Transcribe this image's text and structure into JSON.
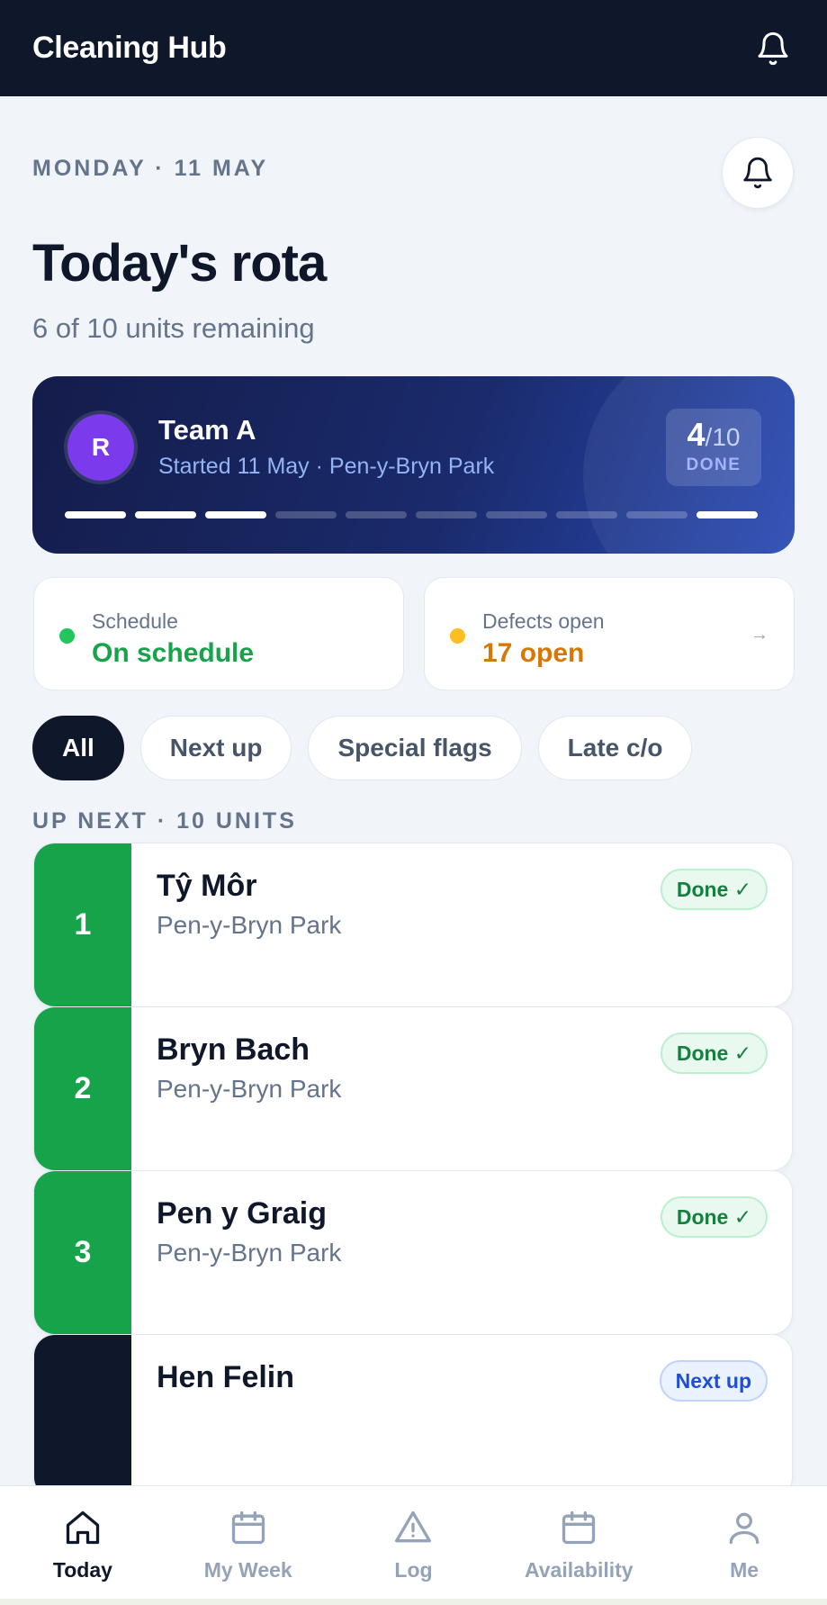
{
  "header": {
    "title": "Cleaning Hub",
    "bell_icon": "bell-icon"
  },
  "date_label": "MONDAY · 11 MAY",
  "page_title": "Today's rota",
  "page_subtitle": "6 of 10 units remaining",
  "team": {
    "avatar_initial": "R",
    "name": "Team A",
    "meta": "Started 11 May · Pen-y-Bryn Park",
    "done_count": "4",
    "done_total": "/10",
    "done_label": "DONE",
    "progress_segments": [
      true,
      true,
      true,
      false,
      false,
      false,
      false,
      false,
      false,
      true
    ]
  },
  "stats": {
    "schedule": {
      "label": "Schedule",
      "value": "On schedule",
      "color": "#16a34a",
      "dot_color": "#22c55e"
    },
    "defects": {
      "label": "Defects open",
      "value": "17 open",
      "color": "#d97706",
      "dot_color": "#fbbf24",
      "arrow": "→"
    }
  },
  "filters": [
    "All",
    "Next up",
    "Special flags",
    "Late c/o"
  ],
  "active_filter": "All",
  "section_label": "UP NEXT · 10 UNITS",
  "units": [
    {
      "number": "1",
      "name": "Tŷ Môr",
      "location": "Pen-y-Bryn Park",
      "status": "Done ✓",
      "status_type": "done",
      "color": "#16a34a"
    },
    {
      "number": "2",
      "name": "Bryn Bach",
      "location": "Pen-y-Bryn Park",
      "status": "Done ✓",
      "status_type": "done",
      "color": "#16a34a"
    },
    {
      "number": "3",
      "name": "Pen y Graig",
      "location": "Pen-y-Bryn Park",
      "status": "Done ✓",
      "status_type": "done",
      "color": "#16a34a"
    },
    {
      "number": "",
      "name": "Hen Felin",
      "location": "",
      "status": "Next up",
      "status_type": "next",
      "color": "#0f172a"
    }
  ],
  "tabs": [
    {
      "label": "Today",
      "icon": "home-icon",
      "active": true
    },
    {
      "label": "My Week",
      "icon": "calendar-icon",
      "active": false
    },
    {
      "label": "Log",
      "icon": "warning-icon",
      "active": false
    },
    {
      "label": "Availability",
      "icon": "calendar-icon",
      "active": false
    },
    {
      "label": "Me",
      "icon": "user-icon",
      "active": false
    }
  ]
}
